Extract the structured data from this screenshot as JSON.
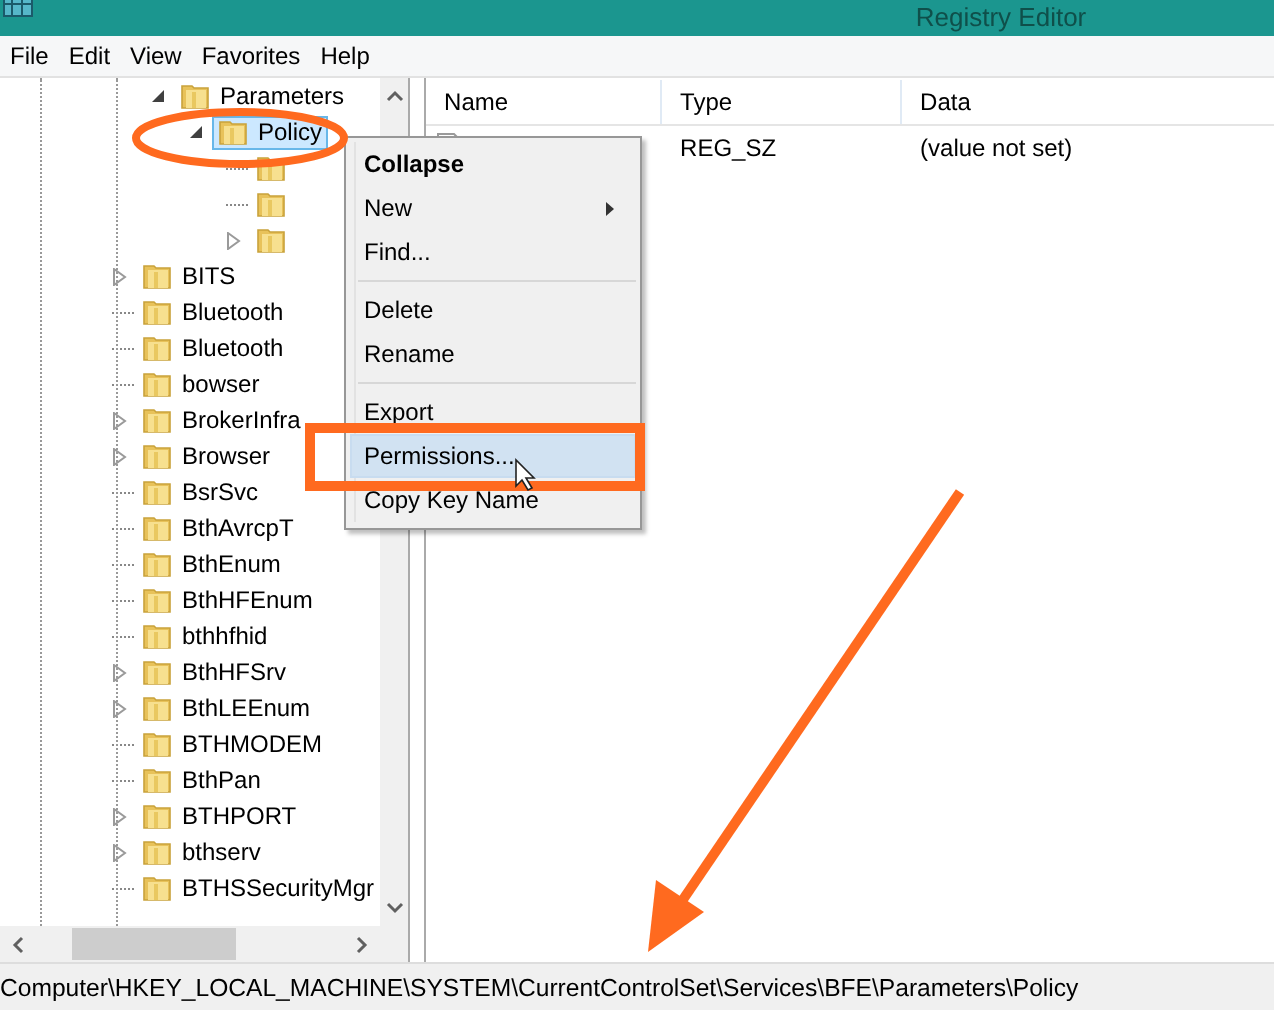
{
  "window": {
    "title": "Registry Editor"
  },
  "menu_bar": [
    "File",
    "Edit",
    "View",
    "Favorites",
    "Help"
  ],
  "tree": {
    "scrolled_branch": [
      {
        "label": "Parameters",
        "has_children": true,
        "expanded": true,
        "selected": false,
        "children": [
          {
            "label": "Policy",
            "has_children": true,
            "expanded": true,
            "selected": true,
            "children": [
              {
                "has_children": false,
                "selected": false
              },
              {
                "has_children": false,
                "selected": false
              },
              {
                "has_children": true,
                "expanded": false,
                "selected": false
              }
            ]
          }
        ]
      }
    ],
    "items": [
      {
        "label": "BITS",
        "has_children": true,
        "expanded": false,
        "selected": false
      },
      {
        "label": "Bluetooth",
        "has_children": false,
        "selected": false
      },
      {
        "label": "Bluetooth",
        "has_children": false,
        "selected": false
      },
      {
        "label": "bowser",
        "has_children": false,
        "selected": false
      },
      {
        "label": "BrokerInfra",
        "has_children": true,
        "expanded": false,
        "selected": false
      },
      {
        "label": "Browser",
        "has_children": true,
        "expanded": false,
        "selected": false
      },
      {
        "label": "BsrSvc",
        "has_children": false,
        "selected": false
      },
      {
        "label": "BthAvrcpT",
        "has_children": false,
        "selected": false
      },
      {
        "label": "BthEnum",
        "has_children": false,
        "selected": false
      },
      {
        "label": "BthHFEnum",
        "has_children": false,
        "selected": false
      },
      {
        "label": "bthhfhid",
        "has_children": false,
        "selected": false
      },
      {
        "label": "BthHFSrv",
        "has_children": true,
        "expanded": false,
        "selected": false
      },
      {
        "label": "BthLEEnum",
        "has_children": true,
        "expanded": false,
        "selected": false
      },
      {
        "label": "BTHMODEM",
        "has_children": false,
        "selected": false
      },
      {
        "label": "BthPan",
        "has_children": false,
        "selected": false
      },
      {
        "label": "BTHPORT",
        "has_children": true,
        "expanded": false,
        "selected": false
      },
      {
        "label": "bthserv",
        "has_children": true,
        "expanded": false,
        "selected": false
      },
      {
        "label": "BTHSSecurityMgr",
        "has_children": false,
        "selected": false
      }
    ]
  },
  "values": {
    "columns": [
      "Name",
      "Type",
      "Data"
    ],
    "rows": [
      {
        "type": "REG_SZ",
        "data": "(value not set)"
      }
    ]
  },
  "context_menu": [
    {
      "kind": "item",
      "label": "Collapse",
      "bold": true,
      "submenu": false,
      "selected": false
    },
    {
      "kind": "item",
      "label": "New",
      "bold": false,
      "submenu": true,
      "selected": false
    },
    {
      "kind": "item",
      "label": "Find...",
      "bold": false,
      "submenu": false,
      "selected": false
    },
    {
      "kind": "separator"
    },
    {
      "kind": "item",
      "label": "Delete",
      "bold": false,
      "submenu": false,
      "selected": false
    },
    {
      "kind": "item",
      "label": "Rename",
      "bold": false,
      "submenu": false,
      "selected": false
    },
    {
      "kind": "separator"
    },
    {
      "kind": "item",
      "label": "Export",
      "bold": false,
      "submenu": false,
      "selected": false
    },
    {
      "kind": "item",
      "label": "Permissions...",
      "bold": false,
      "submenu": false,
      "selected": true
    },
    {
      "kind": "item",
      "label": "Copy Key Name",
      "bold": false,
      "submenu": false,
      "selected": false
    }
  ],
  "status_bar": "Computer\\HKEY_LOCAL_MACHINE\\SYSTEM\\CurrentControlSet\\Services\\BFE\\Parameters\\Policy"
}
